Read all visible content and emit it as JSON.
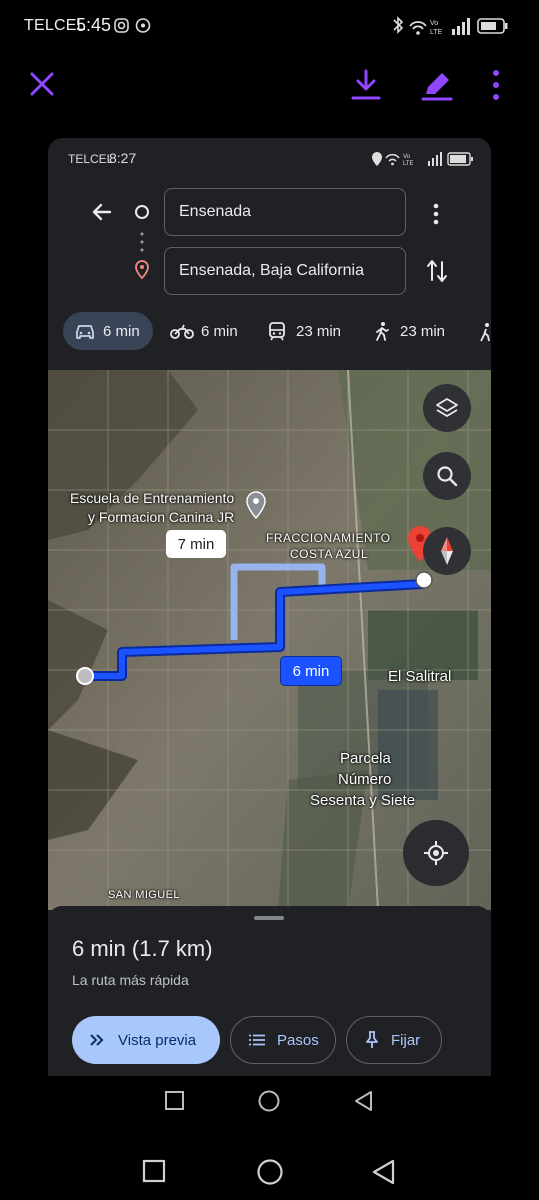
{
  "outer_status": {
    "carrier": "TELCEL",
    "time": "5:45"
  },
  "viewer": {
    "close": "close",
    "download": "download",
    "edit": "edit",
    "more": "more"
  },
  "inner_status": {
    "carrier": "TELCEL",
    "time": "8:27"
  },
  "directions": {
    "origin": "Ensenada",
    "destination": "Ensenada, Baja California"
  },
  "modes": [
    {
      "icon": "car-icon",
      "label": "6 min"
    },
    {
      "icon": "motorcycle-icon",
      "label": "6 min"
    },
    {
      "icon": "transit-icon",
      "label": "23 min"
    },
    {
      "icon": "walk-icon",
      "label": "23 min"
    }
  ],
  "map": {
    "poi_name_1": "Escuela de Entrenamiento",
    "poi_name_2": "y Formacion Canina JR",
    "neighborhood_1": "FRACCIONAMIENTO",
    "neighborhood_2": "COSTA AZUL",
    "alt_route_time": "7 min",
    "main_route_time": "6 min",
    "place_salitral": "El Salitral",
    "parcela_1": "Parcela",
    "parcela_2": "Número",
    "parcela_3": "Sesenta y Siete",
    "san_miguel": "SAN MIGUEL"
  },
  "summary": {
    "duration": "6 min (1.7 km)",
    "subtitle": "La ruta más rápida",
    "preview_label": "Vista previa",
    "steps_label": "Pasos",
    "pin_label": "Fijar"
  },
  "colors": {
    "route": "#1a53ff",
    "alt_route": "#9ab8f5",
    "accent": "#9146ff",
    "preview_bg": "#a8c7fa"
  }
}
